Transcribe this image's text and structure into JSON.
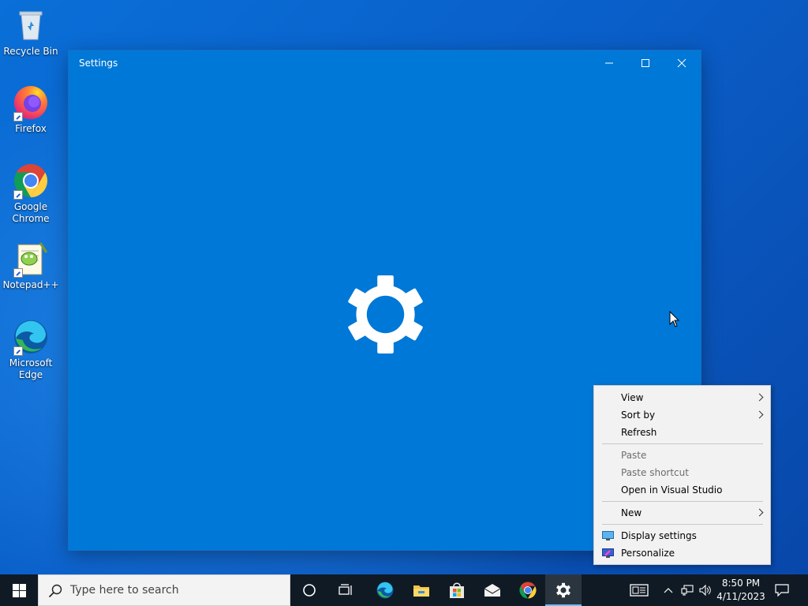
{
  "desktop": {
    "icons": [
      {
        "label": "Recycle Bin",
        "icon": "recycle-bin-icon"
      },
      {
        "label": "Firefox",
        "icon": "firefox-icon"
      },
      {
        "label_line1": "Google",
        "label_line2": "Chrome",
        "icon": "chrome-icon"
      },
      {
        "label": "Notepad++",
        "icon": "notepad-plus-plus-icon"
      },
      {
        "label_line1": "Microsoft",
        "label_line2": "Edge",
        "icon": "edge-icon"
      }
    ]
  },
  "settings_window": {
    "title": "Settings",
    "splash_icon": "gear-icon",
    "controls": [
      "minimize-icon",
      "maximize-icon",
      "close-icon"
    ],
    "background_color": "#0078d7"
  },
  "context_menu": {
    "items": [
      {
        "label": "View",
        "has_submenu": true,
        "enabled": true
      },
      {
        "label": "Sort by",
        "has_submenu": true,
        "enabled": true
      },
      {
        "label": "Refresh",
        "enabled": true
      },
      {
        "label": "Paste",
        "enabled": false
      },
      {
        "label": "Paste shortcut",
        "enabled": false
      },
      {
        "label": "Open in Visual Studio",
        "enabled": true
      },
      {
        "label": "New",
        "has_submenu": true,
        "enabled": true
      },
      {
        "label": "Display settings",
        "icon": "display-icon",
        "enabled": true
      },
      {
        "label": "Personalize",
        "icon": "personalize-icon",
        "enabled": true
      }
    ]
  },
  "taskbar": {
    "search_placeholder": "Type here to search",
    "pinned": [
      "cortana-icon",
      "task-view-icon",
      "edge-icon",
      "file-explorer-icon",
      "store-icon",
      "mail-icon",
      "chrome-icon",
      "settings-icon"
    ],
    "active_app": "settings-icon",
    "tray": [
      "news-icon",
      "chevron-up-icon",
      "network-icon",
      "volume-icon",
      "notification-icon"
    ],
    "time": "8:50 PM",
    "date": "4/11/2023"
  }
}
